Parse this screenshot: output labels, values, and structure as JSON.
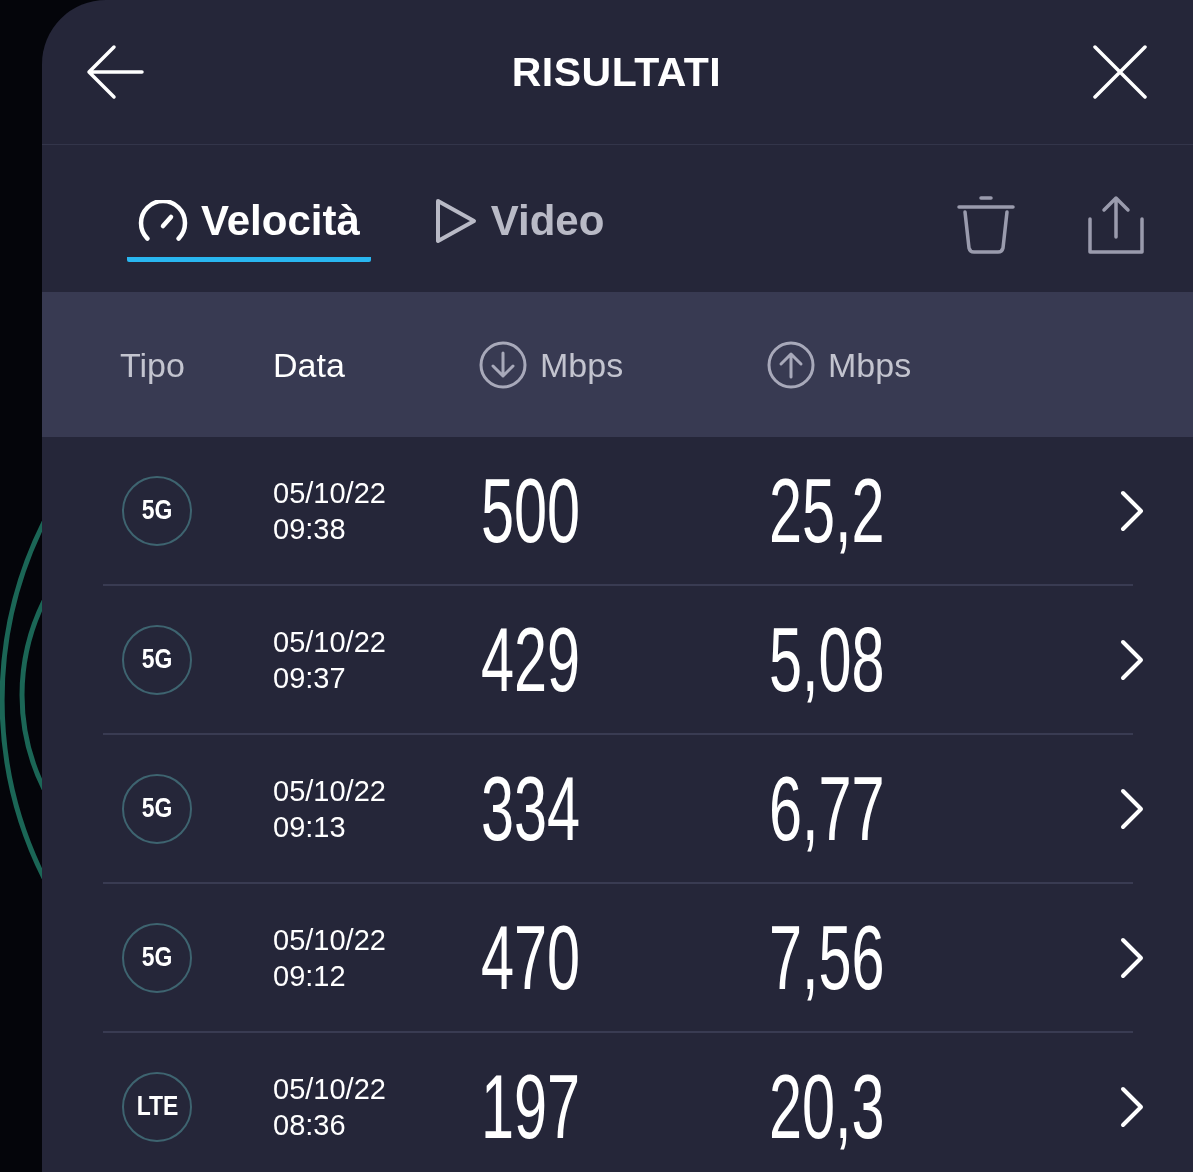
{
  "header": {
    "title": "RISULTATI"
  },
  "tabs": [
    {
      "label": "Velocità",
      "kind": "speed",
      "selected": true
    },
    {
      "label": "Video",
      "kind": "video",
      "selected": false
    }
  ],
  "table": {
    "columns": [
      {
        "label": "Tipo",
        "kind": "text",
        "selected": false
      },
      {
        "label": "Data",
        "kind": "text",
        "selected": true
      },
      {
        "label": "Mbps",
        "kind": "download",
        "selected": false
      },
      {
        "label": "Mbps",
        "kind": "upload",
        "selected": false
      }
    ],
    "rows": [
      {
        "type": "5G",
        "date": "05/10/22",
        "time": "09:38",
        "download": "500",
        "upload": "25,2"
      },
      {
        "type": "5G",
        "date": "05/10/22",
        "time": "09:37",
        "download": "429",
        "upload": "5,08"
      },
      {
        "type": "5G",
        "date": "05/10/22",
        "time": "09:13",
        "download": "334",
        "upload": "6,77"
      },
      {
        "type": "5G",
        "date": "05/10/22",
        "time": "09:12",
        "download": "470",
        "upload": "7,56"
      },
      {
        "type": "LTE",
        "date": "05/10/22",
        "time": "08:36",
        "download": "197",
        "upload": "20,3"
      }
    ]
  }
}
